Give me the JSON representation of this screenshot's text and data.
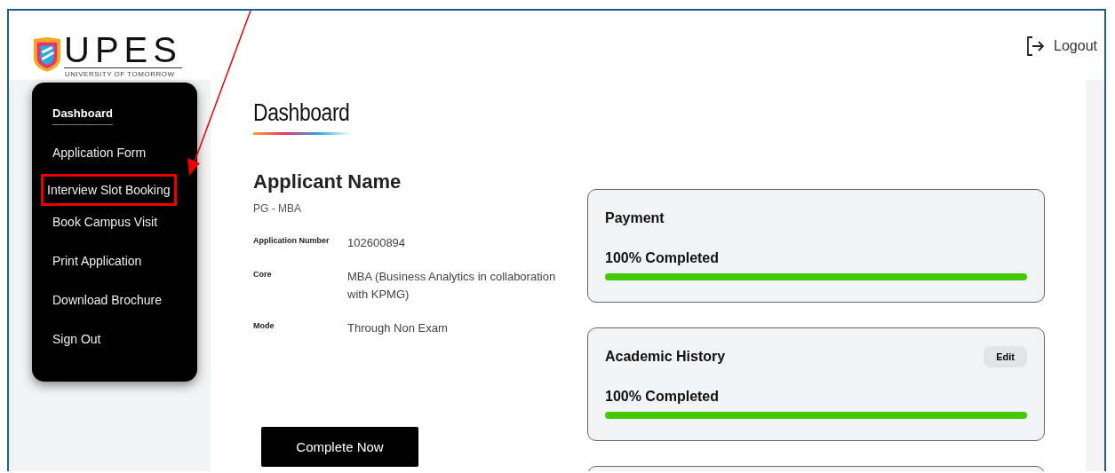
{
  "logo": {
    "wordmark": "UPES",
    "tagline": "UNIVERSITY OF TOMORROW"
  },
  "header": {
    "logout": "Logout"
  },
  "sidebar": {
    "items": [
      {
        "label": "Dashboard",
        "selected": true,
        "highlighted": false
      },
      {
        "label": "Application Form",
        "selected": false,
        "highlighted": false
      },
      {
        "label": "Interview Slot Booking",
        "selected": false,
        "highlighted": true
      },
      {
        "label": "Book Campus Visit",
        "selected": false,
        "highlighted": false
      },
      {
        "label": "Print Application",
        "selected": false,
        "highlighted": false
      },
      {
        "label": "Download Brochure",
        "selected": false,
        "highlighted": false
      },
      {
        "label": "Sign Out",
        "selected": false,
        "highlighted": false
      }
    ]
  },
  "page_title": "Dashboard",
  "applicant": {
    "name": "Applicant Name",
    "program": "PG - MBA",
    "fields": [
      {
        "label": "Application Number",
        "value": "102600894"
      },
      {
        "label": "Core",
        "value": "MBA (Business Analytics in collaboration with KPMG)"
      },
      {
        "label": "Mode",
        "value": "Through Non Exam"
      }
    ]
  },
  "complete_button": "Complete Now",
  "cards": [
    {
      "title": "Payment",
      "status": "100% Completed",
      "level": 1.0
    },
    {
      "title": "Academic History",
      "action": "Edit",
      "status": "100% Completed",
      "level": 1.0
    }
  ]
}
